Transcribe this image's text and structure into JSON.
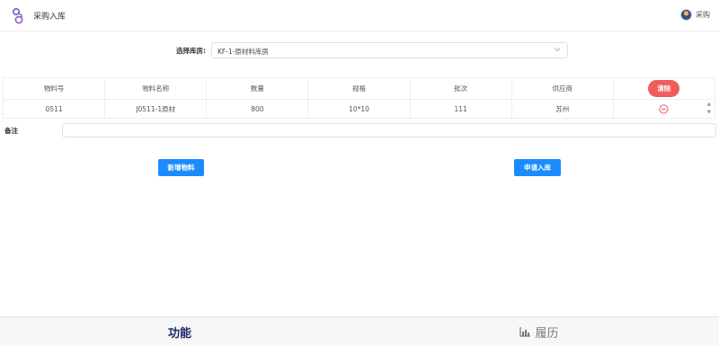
{
  "header": {
    "title": "采购入库",
    "user_name": "采购"
  },
  "warehouse": {
    "label": "选择库房:",
    "selected": "KF-1-原材料库房"
  },
  "table": {
    "columns": [
      "物料号",
      "物料名称",
      "数量",
      "规格",
      "批次",
      "供应商"
    ],
    "clear_label": "清除",
    "rows": [
      [
        "0511",
        "J0511-1原材",
        "800",
        "10*10",
        "111",
        "苏州"
      ]
    ]
  },
  "remarks": {
    "label": "备注",
    "placeholder": ""
  },
  "actions": {
    "add_label": "新增物料",
    "apply_label": "申请入库"
  },
  "bottom_nav": {
    "function_label": "功能",
    "history_label": "履历"
  },
  "colors": {
    "primary": "#1a8cff",
    "danger": "#f05b5b",
    "nav_active": "#1f2a6b"
  }
}
